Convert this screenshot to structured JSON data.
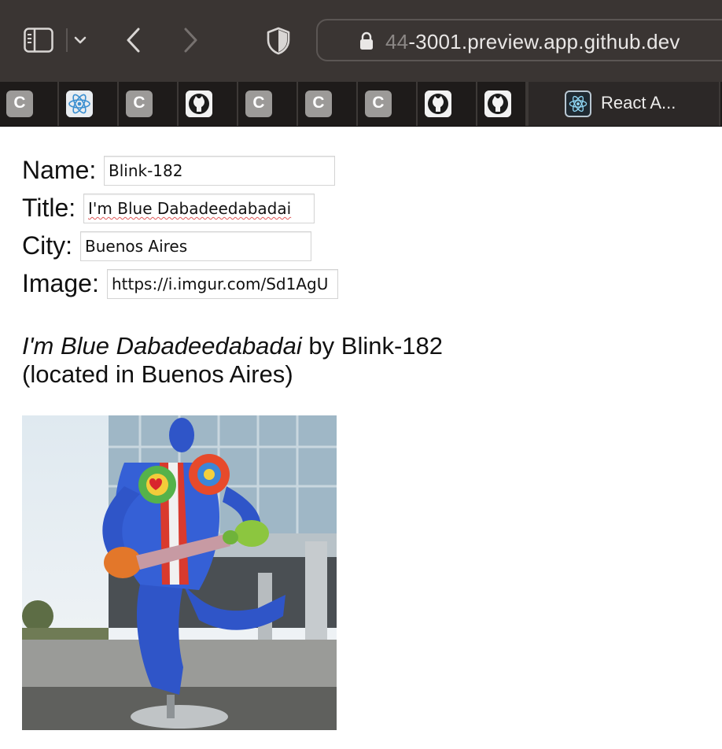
{
  "browser": {
    "url_prefix": "44",
    "url": "-3001.preview.app.github.dev",
    "active_tab_title": "React A...",
    "pinned_tabs": [
      {
        "icon": "c-icon",
        "letter": "C"
      },
      {
        "icon": "react-icon",
        "letter": ""
      },
      {
        "icon": "c-icon",
        "letter": "C"
      },
      {
        "icon": "github-icon",
        "letter": ""
      },
      {
        "icon": "c-icon",
        "letter": "C"
      },
      {
        "icon": "c-icon",
        "letter": "C"
      },
      {
        "icon": "c-icon",
        "letter": "C"
      },
      {
        "icon": "github-icon",
        "letter": ""
      },
      {
        "icon": "github-icon",
        "letter": ""
      }
    ]
  },
  "form": {
    "name_label": "Name:",
    "name_value": "Blink-182",
    "title_label": "Title:",
    "title_value": "I'm Blue Dabadeedabadai",
    "city_label": "City:",
    "city_value": "Buenos Aires",
    "image_label": "Image:",
    "image_value": "https://i.imgur.com/Sd1AgU"
  },
  "summary": {
    "title": "I'm Blue Dabadeedabadai",
    "by": " by ",
    "name": "Blink-182",
    "loc_open": "(located in ",
    "city": "Buenos Aires",
    "loc_close": ")"
  },
  "colors": {
    "toolbar_bg": "#3a3533",
    "tabstrip_bg": "#1e1b1a",
    "sculpture_blue": "#2f55c8"
  }
}
